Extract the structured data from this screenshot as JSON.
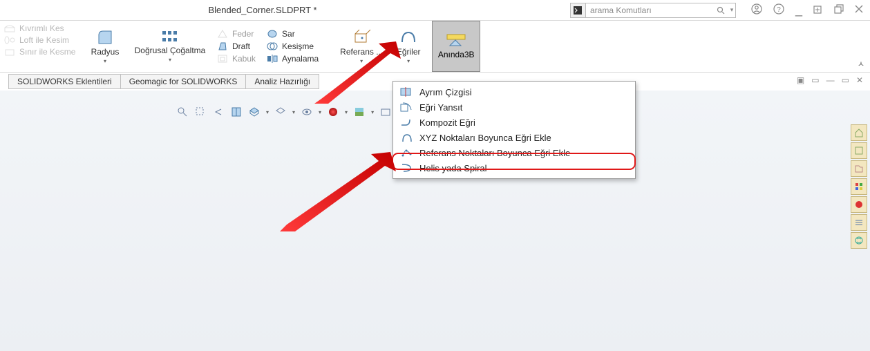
{
  "title": "Blended_Corner.SLDPRT *",
  "search": {
    "placeholder": "arama Komutları"
  },
  "leftcol": {
    "r1": "Kıvrımlı Kes",
    "r2": "Loft ile Kesim",
    "r3": "Sınır ile Kesme"
  },
  "ribbon": {
    "radius": "Radyus",
    "linear_pattern": "Doğrusal Çoğaltma",
    "draft": "Draft",
    "shell": "Kabuk",
    "wrap": "Sar",
    "intersect": "Kesişme",
    "mirror": "Aynalama",
    "feder": "Feder",
    "ref_geo": "Referans ...",
    "curves": "Eğriler",
    "instant3d": "Anında3B"
  },
  "tabs": {
    "t1": "SOLIDWORKS Eklentileri",
    "t2": "Geomagic for SOLIDWORKS",
    "t3": "Analiz Hazırlığı"
  },
  "dropdown": {
    "i1": "Ayrım Çizgisi",
    "i2": "Eğri Yansıt",
    "i3": "Kompozit Eğri",
    "i4": "XYZ Noktaları Boyunca Eğri Ekle",
    "i5": "Referans Noktaları Boyunca Eğri Ekle",
    "i6": "Helis yada Spiral"
  }
}
